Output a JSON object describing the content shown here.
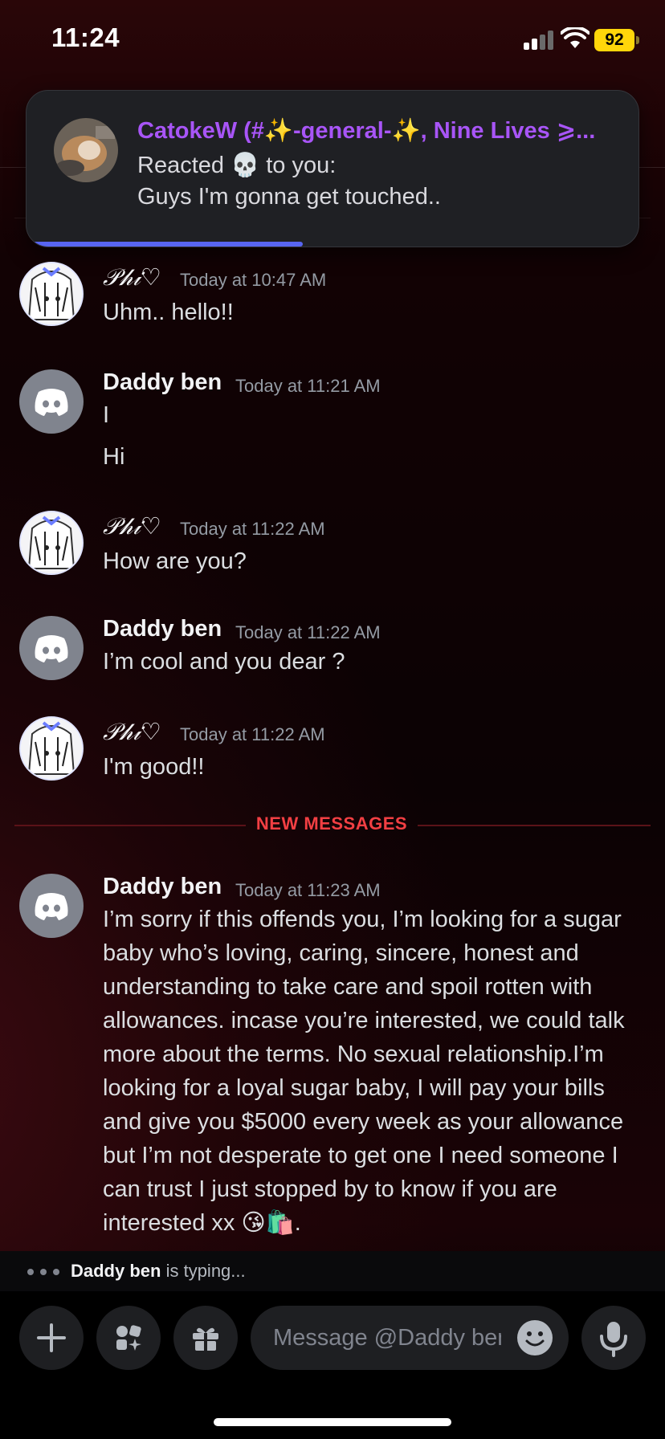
{
  "status_bar": {
    "time": "11:24",
    "battery": "92"
  },
  "notification": {
    "title": "CatokeW (#✨-general-✨, Nine Lives ⩾...",
    "line1": "Reacted 💀 to you:",
    "line2": "Guys I'm gonna get touched..",
    "progress": 0.45
  },
  "messages": [
    {
      "author": "𝒫𝒽𝒾♡",
      "time": "Today at 10:47 AM",
      "lines": [
        "Uhm.. hello!!"
      ]
    },
    {
      "author": "Daddy ben",
      "time": "Today at 11:21 AM",
      "lines": [
        "I",
        "Hi"
      ]
    },
    {
      "author": "𝒫𝒽𝒾♡",
      "time": "Today at 11:22 AM",
      "lines": [
        "How are you?"
      ]
    },
    {
      "author": "Daddy ben",
      "time": "Today at 11:22 AM",
      "lines": [
        "I’m cool and you dear ?"
      ]
    },
    {
      "author": "𝒫𝒽𝒾♡",
      "time": "Today at 11:22 AM",
      "lines": [
        "I'm good!!"
      ]
    },
    {
      "author": "Daddy ben",
      "time": "Today at 11:23 AM",
      "lines": [
        "I’m sorry if this offends you, I’m looking for a sugar baby who’s loving, caring, sincere, honest and understanding to take care and spoil rotten with allowances. incase  you’re interested, we could talk more about the terms. No sexual relationship.I’m looking for a loyal sugar baby, I will pay your bills and give you $5000 every week as your allowance but I’m not desperate to get one I need someone I can trust I just stopped by to know if you are interested xx 😘🛍️."
      ]
    }
  ],
  "new_messages_label": "NEW MESSAGES",
  "typing": {
    "name": "Daddy ben",
    "suffix": " is typing..."
  },
  "composer": {
    "placeholder": "Message @Daddy ben"
  },
  "colors": {
    "accent": "#5865f2",
    "new_messages": "#f23f43",
    "notif_title": "#a855f7"
  }
}
